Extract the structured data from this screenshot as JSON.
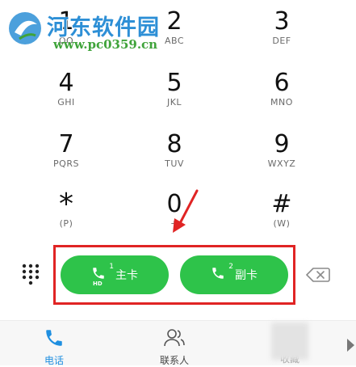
{
  "keypad": {
    "keys": [
      {
        "digit": "1",
        "letters": "OO"
      },
      {
        "digit": "2",
        "letters": "ABC"
      },
      {
        "digit": "3",
        "letters": "DEF"
      },
      {
        "digit": "4",
        "letters": "GHI"
      },
      {
        "digit": "5",
        "letters": "JKL"
      },
      {
        "digit": "6",
        "letters": "MNO"
      },
      {
        "digit": "7",
        "letters": "PQRS"
      },
      {
        "digit": "8",
        "letters": "TUV"
      },
      {
        "digit": "9",
        "letters": "WXYZ"
      },
      {
        "digit": "*",
        "letters": "(P)"
      },
      {
        "digit": "0",
        "letters": "+"
      },
      {
        "digit": "#",
        "letters": "(W)"
      }
    ]
  },
  "watermark": {
    "title": "河东软件园",
    "url": "www.pc0359.cn"
  },
  "call_buttons": {
    "sim1": {
      "label": "主卡",
      "sim_number": "1",
      "badge": "HD"
    },
    "sim2": {
      "label": "副卡",
      "sim_number": "2"
    }
  },
  "bottom_nav": {
    "items": [
      {
        "label": "电话",
        "active": true
      },
      {
        "label": "联系人",
        "active": false
      },
      {
        "label": "收藏",
        "active": false
      }
    ]
  },
  "colors": {
    "accent_green": "#2ec34a",
    "highlight_red": "#e02424",
    "active_tab_blue": "#1f8fe0"
  }
}
